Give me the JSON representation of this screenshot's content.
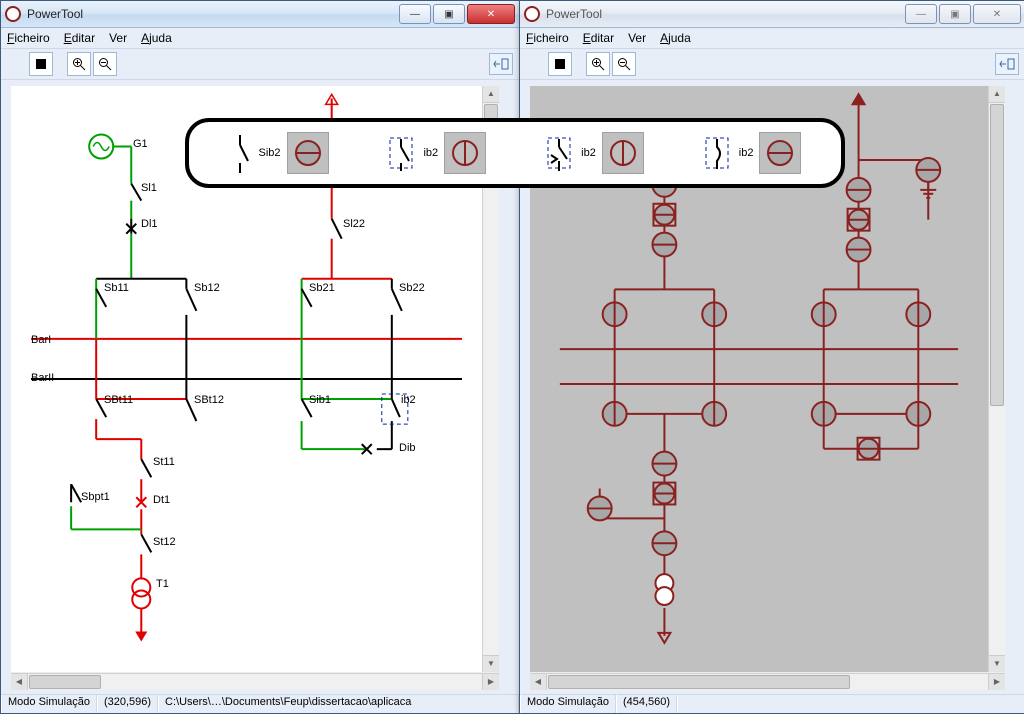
{
  "window": {
    "title": "PowerTool",
    "buttons": {
      "min_glyph": "—",
      "max_glyph": "▣",
      "close_glyph": "✕"
    }
  },
  "menu": {
    "file": "Ficheiro",
    "edit": "Editar",
    "view": "Ver",
    "help": "Ajuda"
  },
  "toolbar": {
    "zoom_in": "+",
    "zoom_out": "−",
    "dock_glyph": "⇤◫"
  },
  "status_left": {
    "mode": "Modo Simulação",
    "coord": "(320,596)",
    "path": "C:\\Users\\…\\Documents\\Feup\\dissertacao\\aplicaca"
  },
  "status_right": {
    "mode": "Modo Simulação",
    "coord": "(454,560)"
  },
  "labels": {
    "G1": "G1",
    "Sl1": "Sl1",
    "Dl1": "Dl1",
    "Sl22": "Sl22",
    "Sb11": "Sb11",
    "Sb12": "Sb12",
    "Sb21": "Sb21",
    "Sb22": "Sb22",
    "BarI": "BarI",
    "BarII": "BarII",
    "SBt11": "SBt11",
    "SBt12": "SBt12",
    "Sib1": "Sib1",
    "Sib2_boxed": "ib2",
    "St11": "St11",
    "Dib": "Dib",
    "Sbpt1": "Sbpt1",
    "Dt1": "Dt1",
    "St12": "St12",
    "T1": "T1"
  },
  "palette": {
    "item1_text": "Sib2",
    "item2_text": "ib2",
    "item3_text": "ib2",
    "item4_text": "ib2"
  },
  "colors": {
    "red": "#e00000",
    "green": "#00a000",
    "black": "#000000",
    "accent": "#3a6aa8",
    "darkred": "#8a2020"
  }
}
